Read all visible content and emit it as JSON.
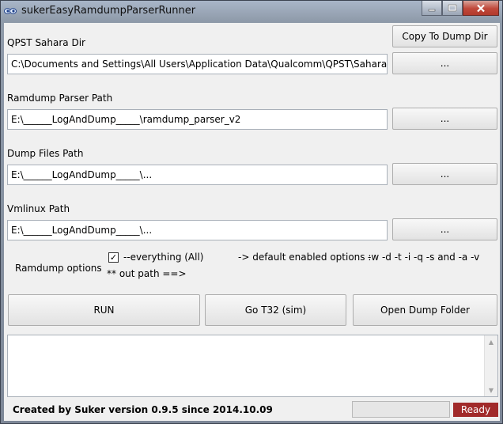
{
  "window": {
    "title": "sukerEasyRamdumpParserRunner",
    "icon": "app-eyes-icon",
    "controls": {
      "minimize": "minimize-icon",
      "maximize": "maximize-icon",
      "close": "close-icon"
    }
  },
  "fields": [
    {
      "label": "QPST Sahara Dir",
      "value": "C:\\Documents and Settings\\All Users\\Application Data\\Qualcomm\\QPST\\Sahara\\",
      "button": "..."
    },
    {
      "label": "Ramdump Parser Path",
      "value": "E:\\______LogAndDump_____\\ramdump_parser_v2",
      "button": "..."
    },
    {
      "label": "Dump Files Path",
      "value": "E:\\______LogAndDump_____\\...",
      "button": "..."
    },
    {
      "label": "Vmlinux Path",
      "value": "E:\\______LogAndDump_____\\...",
      "button": "..."
    }
  ],
  "copy_button": "Copy To Dump Dir",
  "options": {
    "label": "Ramdump options",
    "checkbox_label": "--everything (All)",
    "checked": true,
    "defaults_text": "-> default enabled options :",
    "defaults_flags": "-w -d -t -i -q -s and -a -v",
    "out_path": "** out path ==>"
  },
  "actions": {
    "run": "RUN",
    "go_t32": "Go T32 (sim)",
    "open_folder": "Open Dump Folder"
  },
  "log": {
    "value": ""
  },
  "footer": {
    "credit": "Created by Suker version 0.9.5   since 2014.10.09",
    "progress": 0,
    "status": "Ready",
    "status_color": "#a12a2a"
  }
}
